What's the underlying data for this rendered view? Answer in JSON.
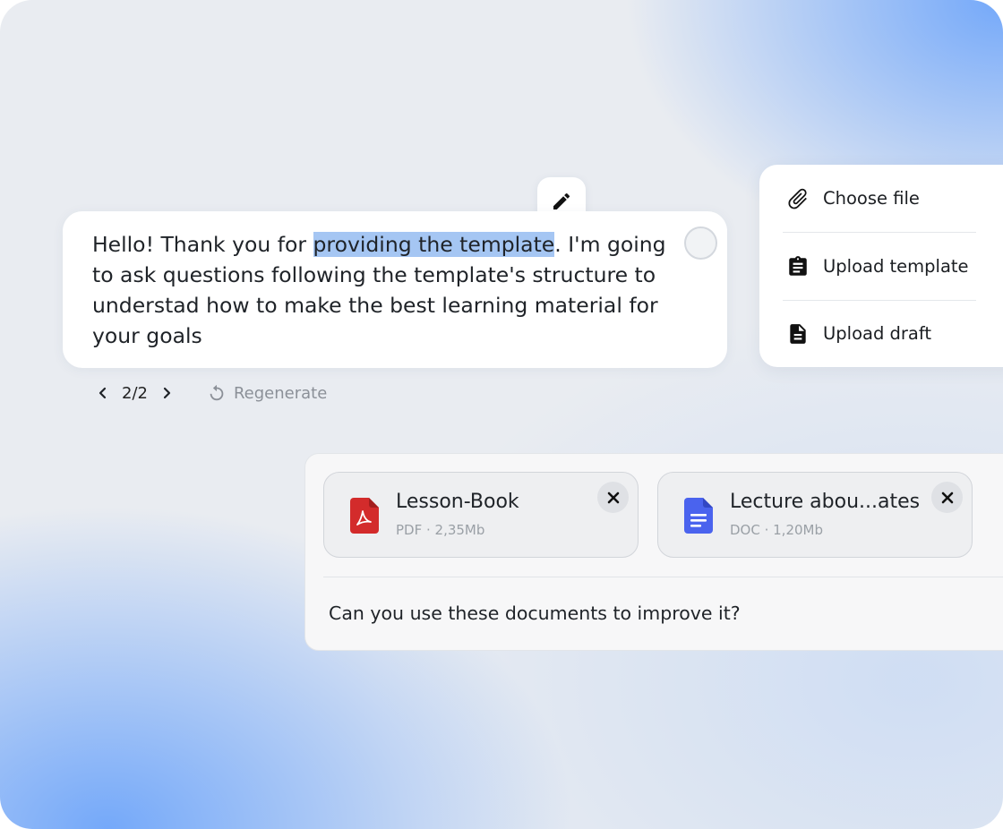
{
  "message": {
    "text_before": "Hello! Thank you for ",
    "text_highlight": "providing the template",
    "text_after": ". I'm going to ask questions following the template's structure to understad how to make the best learning material for your goals"
  },
  "icons": {
    "edit": "pencil-icon",
    "prev": "chevron-left-icon",
    "next": "chevron-right-icon",
    "regenerate": "refresh-icon",
    "choose_file": "paperclip-icon",
    "upload_template": "clipboard-icon",
    "upload_draft": "document-icon",
    "pdf": "pdf-file-icon",
    "doc": "doc-file-icon",
    "close": "close-icon"
  },
  "response_controls": {
    "page_indicator": "2/2",
    "regenerate_label": "Regenerate"
  },
  "upload_menu": {
    "items": [
      {
        "label": "Choose file"
      },
      {
        "label": "Upload template"
      },
      {
        "label": "Upload draft"
      }
    ]
  },
  "composer": {
    "attachments": [
      {
        "name": "Lesson-Book",
        "meta": "PDF · 2,35Mb"
      },
      {
        "name": "Lecture abou...ates",
        "meta": "DOC · 1,20Mb"
      }
    ],
    "input_text": "Can you use these documents to improve it?"
  },
  "colors": {
    "highlight": "#a5c6f3",
    "pdf_red": "#d32b2b",
    "doc_blue": "#4a63ee",
    "background": "#e9ecf1",
    "accent_gradient": "#6ea5fa"
  }
}
